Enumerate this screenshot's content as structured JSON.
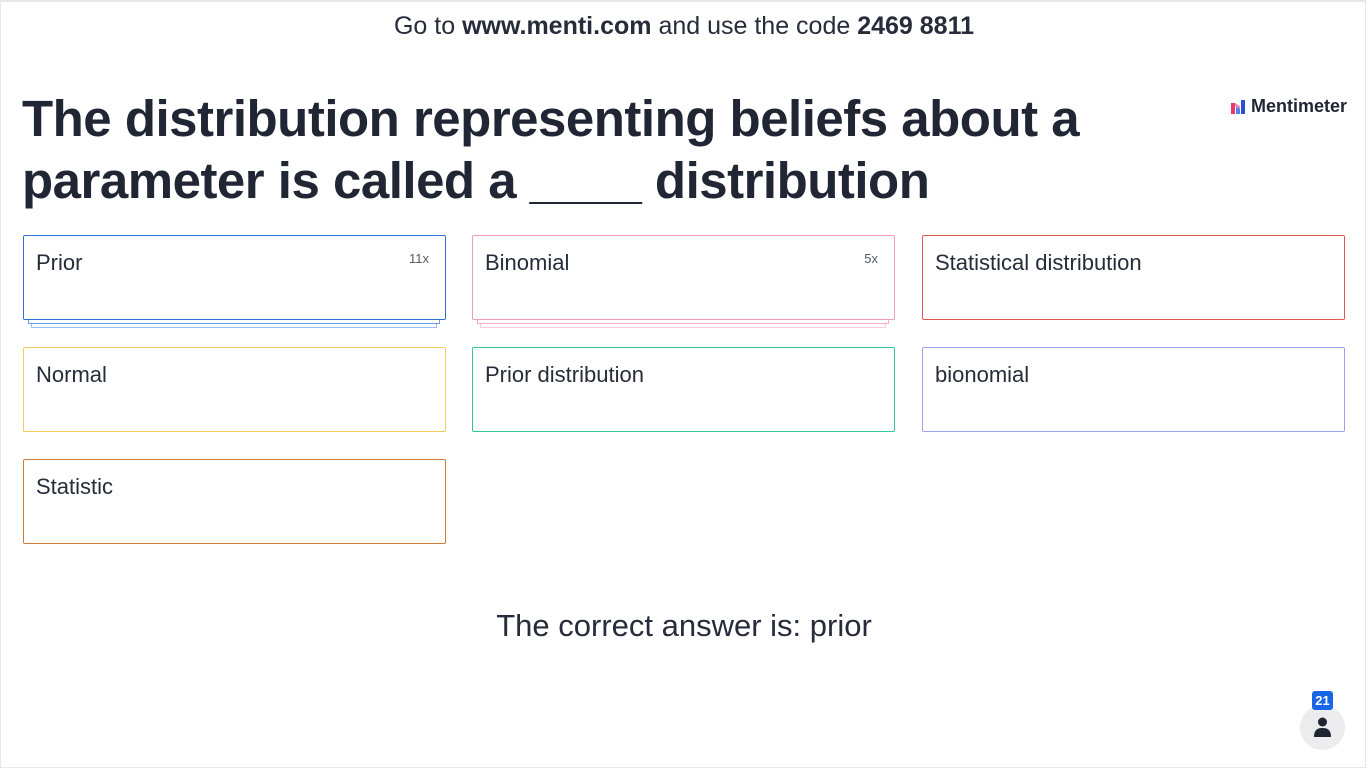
{
  "header": {
    "prefix": "Go to",
    "url": "www.menti.com",
    "middle": "and use the code",
    "code": "2469 8811"
  },
  "question": {
    "title": "The distribution representing beliefs about a parameter is called a ____ distribution"
  },
  "brand": {
    "name": "Mentimeter",
    "logo_icon": "mentimeter-logo-icon"
  },
  "responses": [
    {
      "label": "Prior",
      "count": "11x",
      "color": "#2f6fdc"
    },
    {
      "label": "Binomial",
      "count": "5x",
      "color": "#f29bb9"
    },
    {
      "label": "Statistical distribution",
      "count": "",
      "color": "#e4564f"
    },
    {
      "label": "Normal",
      "count": "",
      "color": "#f6cc5a"
    },
    {
      "label": "Prior distribution",
      "count": "",
      "color": "#33c69a"
    },
    {
      "label": "bionomial",
      "count": "",
      "color": "#9aa3ee"
    },
    {
      "label": "Statistic",
      "count": "",
      "color": "#d07a35"
    }
  ],
  "answer": {
    "text": "The correct answer is: prior"
  },
  "participants": {
    "count": "21",
    "icon": "person-icon"
  }
}
